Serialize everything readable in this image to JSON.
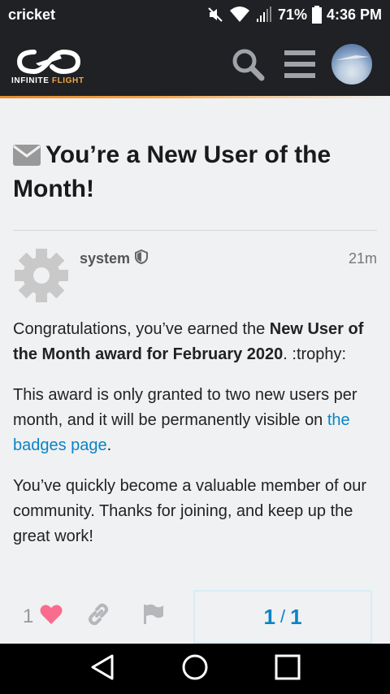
{
  "status_bar": {
    "carrier": "cricket",
    "battery": "71%",
    "time": "4:36 PM"
  },
  "header": {
    "brand_left": "INFINITE",
    "brand_right": "FLIGHT",
    "icons": [
      "search-icon",
      "hamburger-menu-icon",
      "user-avatar"
    ],
    "accent_color": "#f5a54a"
  },
  "topic": {
    "title": "You’re a New User of the Month!"
  },
  "post": {
    "author": "system",
    "time": "21m",
    "p1_pre": "Congratulations, you’ve earned the ",
    "p1_bold": "New User of the Month award for February 2020",
    "p1_post": ". :trophy:",
    "p2_pre": "This award is only granted to two new users per month, and it will be permanently visible on ",
    "p2_link": "the badges page",
    "p2_post": ".",
    "p3": "You’ve quickly become a valuable member of our community. Thanks for joining, and keep up the great work!"
  },
  "actions": {
    "like_count": "1"
  },
  "progress": {
    "current": "1",
    "separator": "/",
    "total": "1"
  },
  "colors": {
    "link": "#0a84c5",
    "heart": "#fa6c8d",
    "header_bg": "#1f2124"
  }
}
